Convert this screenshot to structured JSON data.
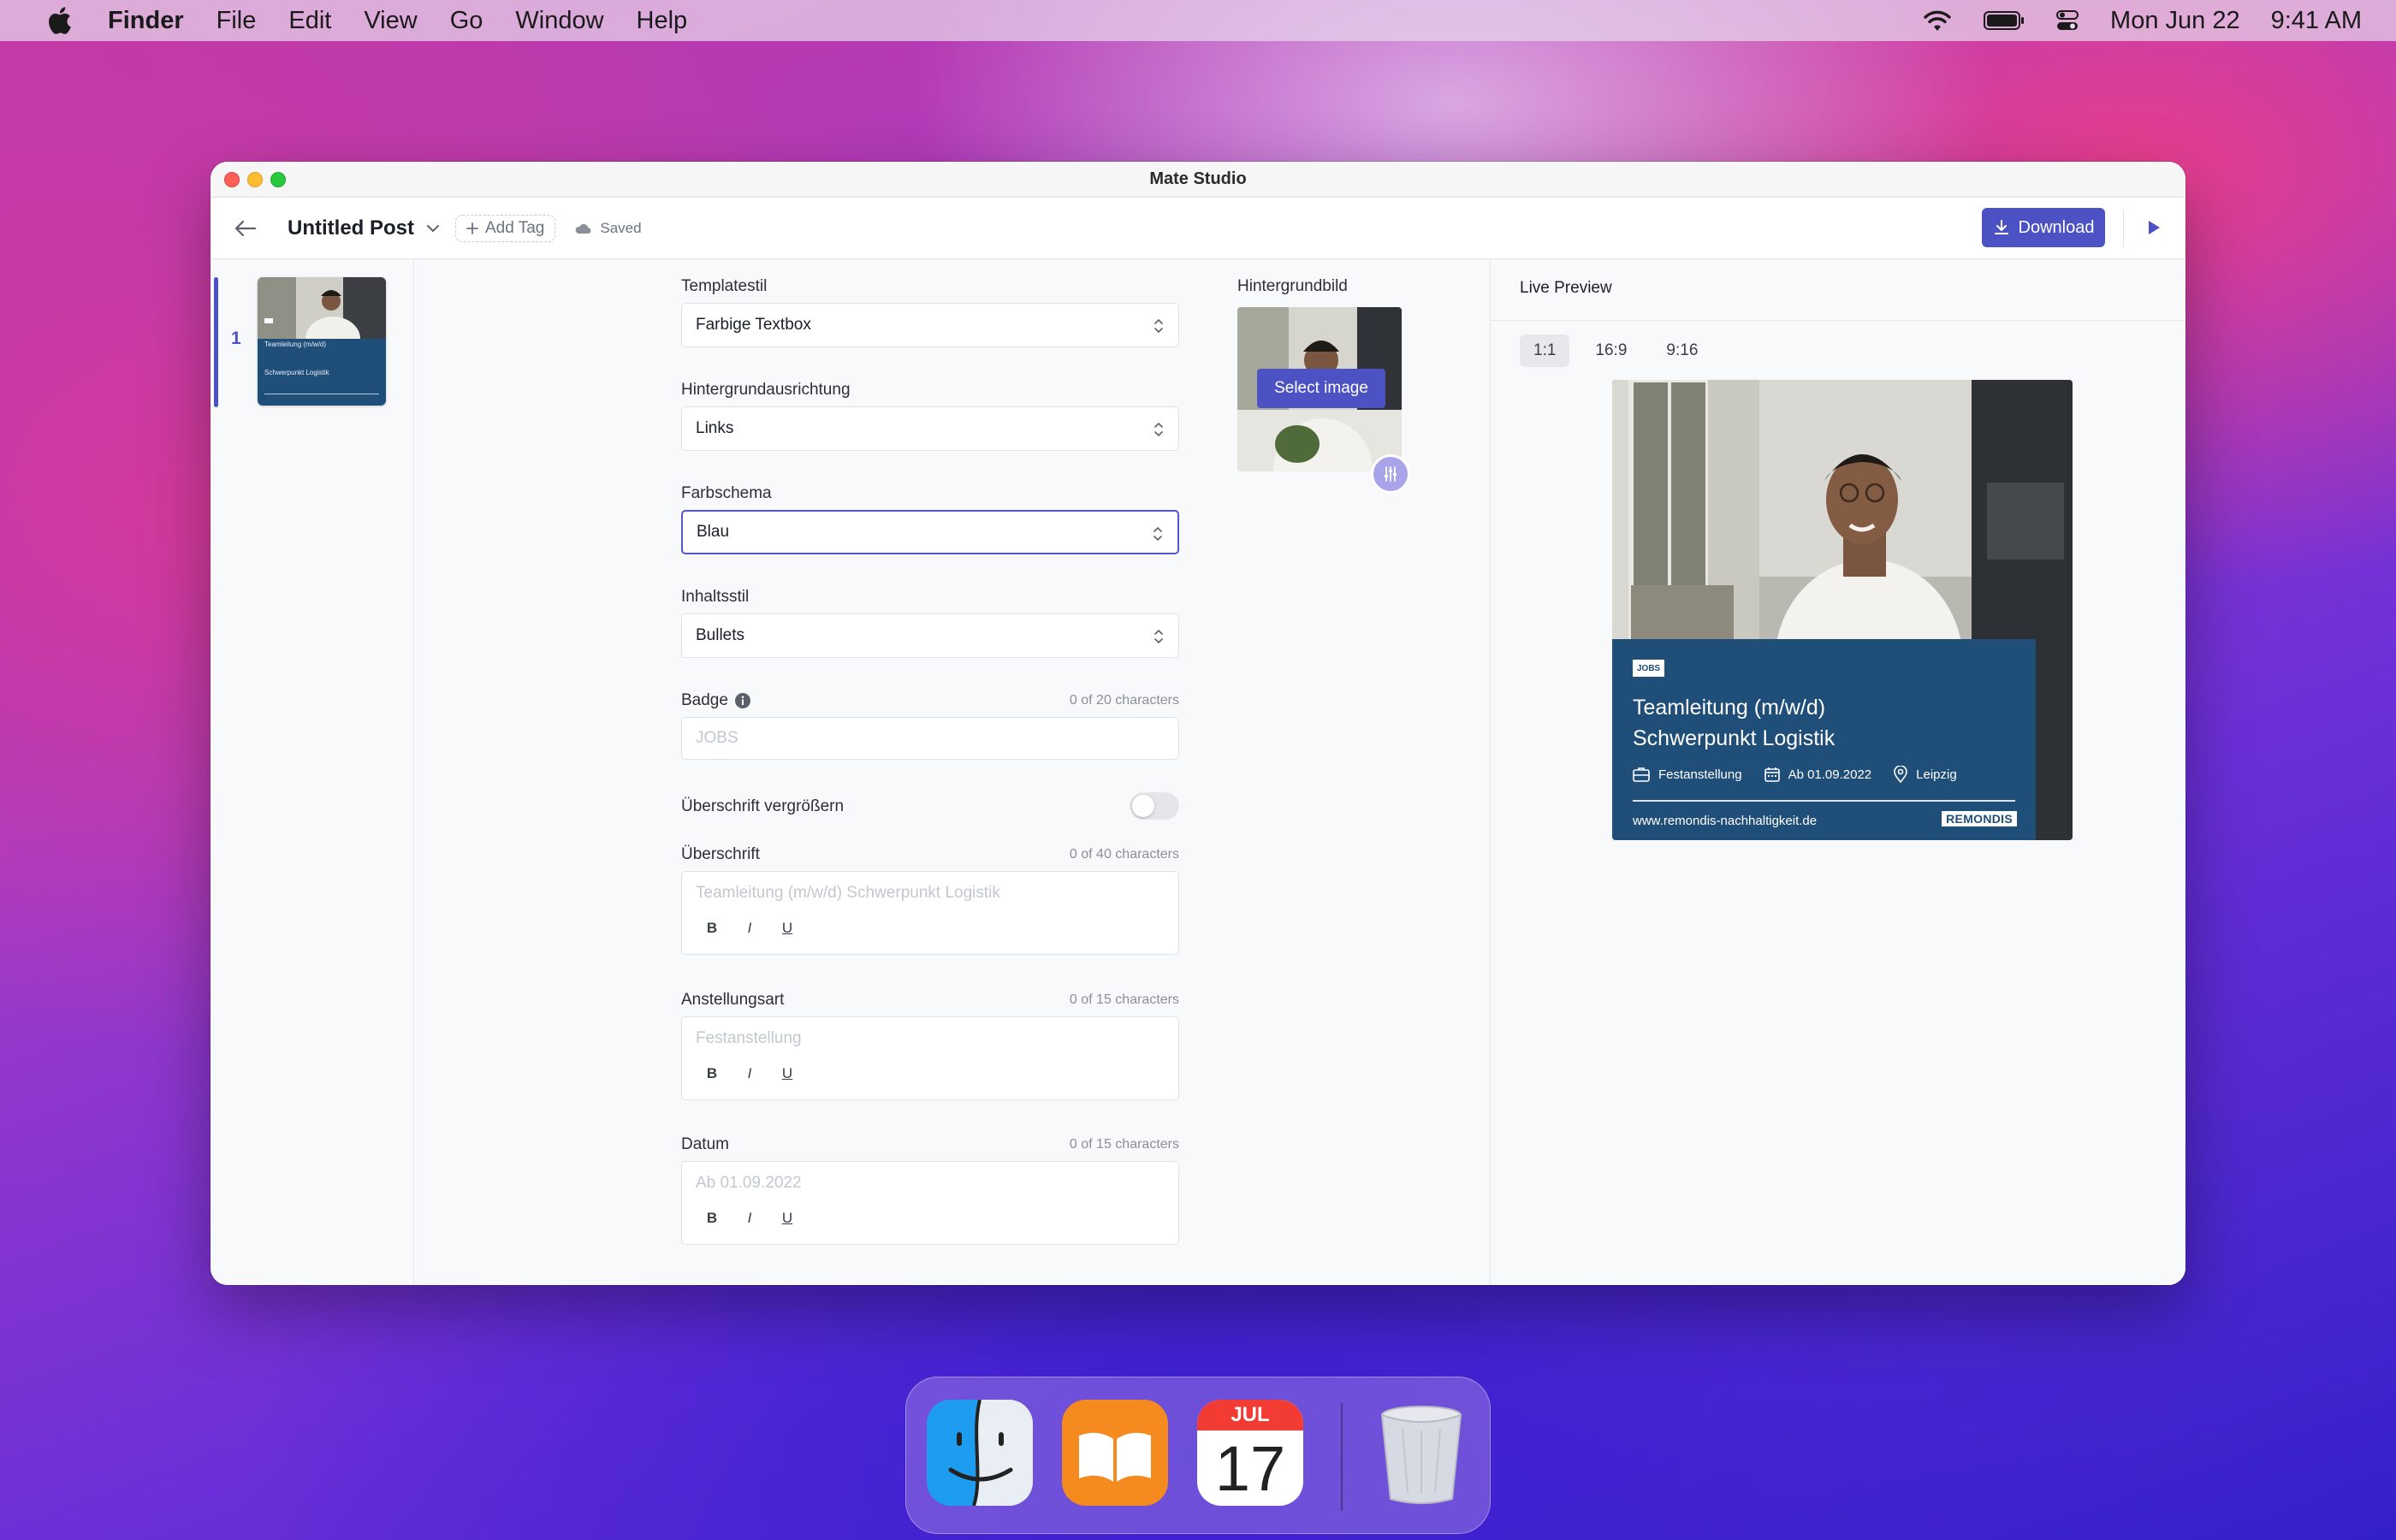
{
  "menubar": {
    "app_name": "Finder",
    "menus": [
      "File",
      "Edit",
      "View",
      "Go",
      "Window",
      "Help"
    ],
    "date": "Mon Jun 22",
    "time": "9:41 AM"
  },
  "window": {
    "title": "Mate Studio"
  },
  "toolbar": {
    "post_title": "Untitled Post",
    "add_tag_label": "Add Tag",
    "saved_label": "Saved",
    "download_label": "Download"
  },
  "slides": [
    {
      "number": "1",
      "thumb_title": "Teamleitung (m/w/d)",
      "thumb_subtitle": "Schwerpunkt Logistik"
    }
  ],
  "form": {
    "template_style": {
      "label": "Templatestil",
      "value": "Farbige Textbox"
    },
    "bg_alignment": {
      "label": "Hintergrundausrichtung",
      "value": "Links"
    },
    "color_scheme": {
      "label": "Farbschema",
      "value": "Blau"
    },
    "content_style": {
      "label": "Inhaltsstil",
      "value": "Bullets"
    },
    "badge": {
      "label": "Badge",
      "counter": "0 of 20 characters",
      "placeholder": "JOBS"
    },
    "enlarge_heading": {
      "label": "Überschrift vergrößern",
      "enabled": false
    },
    "heading": {
      "label": "Überschrift",
      "counter": "0 of 40 characters",
      "placeholder": "Teamleitung (m/w/d) Schwerpunkt Logistik"
    },
    "employment_type": {
      "label": "Anstellungsart",
      "counter": "0 of 15 characters",
      "placeholder": "Festanstellung"
    },
    "date": {
      "label": "Datum",
      "counter": "0 of 15 characters",
      "placeholder": "Ab 01.09.2022"
    },
    "format_bold": "B",
    "format_italic": "I",
    "format_underline": "U"
  },
  "background_image": {
    "label": "Hintergrundbild",
    "select_label": "Select image"
  },
  "preview": {
    "title": "Live Preview",
    "ratios": [
      "1:1",
      "16:9",
      "9:16"
    ],
    "active_ratio": "1:1",
    "card": {
      "badge": "JOBS",
      "headline_line1": "Teamleitung (m/w/d)",
      "headline_line2": "Schwerpunkt Logistik",
      "employment": "Festanstellung",
      "date": "Ab 01.09.2022",
      "location": "Leipzig",
      "url": "www.remondis-nachhaltigkeit.de",
      "logo": "REMONDIS"
    }
  },
  "dock": {
    "apps": [
      "finder-icon",
      "books-icon",
      "calendar-icon",
      "trash-icon"
    ],
    "calendar_month": "JUL",
    "calendar_day": "17"
  },
  "colors": {
    "accent": "#4c52c4",
    "card_blue": "#1f4e79"
  }
}
